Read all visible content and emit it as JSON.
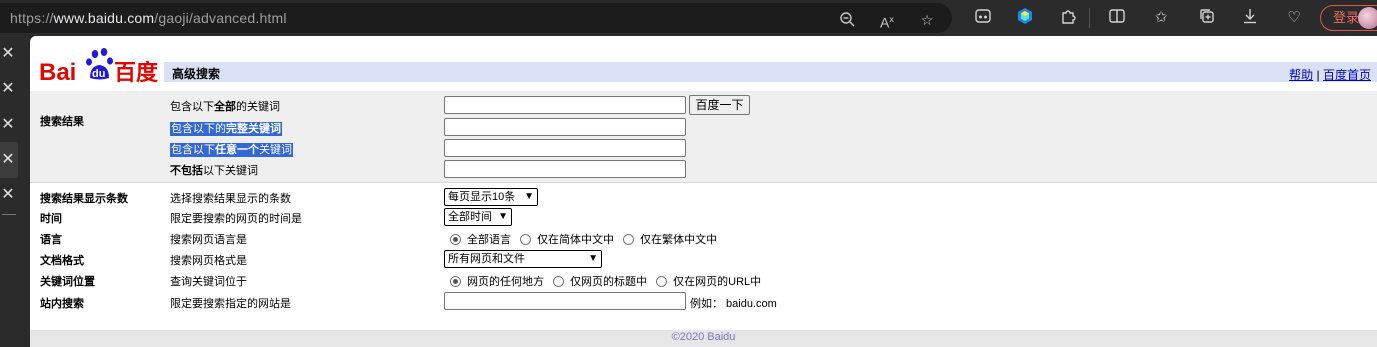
{
  "browser": {
    "url_prefix": "https://",
    "url_host": "www.baidu.com",
    "url_path": "/gaoji/advanced.html",
    "login_label": "登录",
    "accent": "#e0574f"
  },
  "header": {
    "logo_text_left": "Bai",
    "logo_text_paw": "du",
    "logo_text_right": "百度",
    "title": "高级搜索",
    "help_link": "帮助",
    "separator": "|",
    "home_link": "百度首页",
    "bar_color": "#d9e1f7"
  },
  "search_results": {
    "category": "搜索结果",
    "all_words_pre": "包含以下",
    "all_words_kw": "全部",
    "all_words_post": "的关键词",
    "submit_label": "百度一下",
    "exact_pre": "包含以下的",
    "exact_kw": "完整关键词",
    "any_pre": "包含以下",
    "any_kw": "任意一个",
    "any_post": "关键词",
    "exclude_kw": "不包括",
    "exclude_post": "以下关键词"
  },
  "options": {
    "count": {
      "category": "搜索结果显示条数",
      "label": "选择搜索结果显示的条数",
      "value": "每页显示10条"
    },
    "time": {
      "category": "时间",
      "label": "限定要搜索的网页的时间是",
      "value": "全部时间"
    },
    "language": {
      "category": "语言",
      "label": "搜索网页语言是",
      "choices": [
        "全部语言",
        "仅在简体中文中",
        "仅在繁体中文中"
      ],
      "selected": 0
    },
    "format": {
      "category": "文档格式",
      "label": "搜索网页格式是",
      "value": "所有网页和文件"
    },
    "position": {
      "category": "关键词位置",
      "label": "查询关键词位于",
      "choices": [
        "网页的任何地方",
        "仅网页的标题中",
        "仅在网页的URL中"
      ],
      "selected": 0
    },
    "site": {
      "category": "站内搜索",
      "label": "限定要搜索指定的网站是",
      "example": "例如：  baidu.com"
    }
  },
  "footer": {
    "copyright": "©2020 Baidu"
  },
  "icons": [
    "zoom-out-icon",
    "read-aloud-icon",
    "favorite-star-icon",
    "game-controller-icon",
    "extension-gem-icon",
    "extensions-puzzle-icon",
    "split-screen-icon",
    "favorites-list-icon",
    "collections-icon",
    "downloads-icon",
    "performance-heart-icon",
    "close-tab-icon"
  ]
}
